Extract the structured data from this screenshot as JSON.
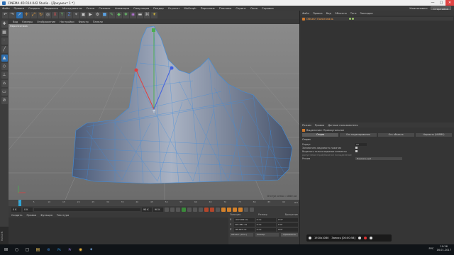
{
  "window": {
    "title": "CINEMA 4D R14.042 Studio - [Документ 1 *]",
    "controls": [
      "—",
      "□",
      "✕"
    ]
  },
  "menubar": {
    "items": [
      "Файл",
      "Правка",
      "Создать",
      "Выделить",
      "Инструменты",
      "Сетка",
      "Снэпинг",
      "Анимация",
      "Симуляция",
      "Рендер",
      "Скульпт",
      "MoGraph",
      "Персонаж",
      "Плагины",
      "Скрипт",
      "Окно",
      "Справка"
    ],
    "layout_label": "Компоновка:",
    "layout_value": "Стартовая"
  },
  "toolbar": {
    "icons": [
      "undo-icon",
      "redo-icon",
      "select-icon",
      "move-icon",
      "scale-icon",
      "rotate-icon",
      "recent-icon",
      "x-axis-icon",
      "y-axis-icon",
      "z-axis-icon",
      "coord-icon",
      "render-view-icon",
      "render-icon",
      "render-settings-icon",
      "cube-icon",
      "pen-icon",
      "subdivision-icon",
      "array-icon",
      "deformer-icon",
      "floor-icon",
      "camera-icon",
      "light-icon"
    ],
    "glyphs": [
      "↶",
      "↷",
      "➚",
      "✛",
      "⤢",
      "↻",
      "◎",
      "X",
      "Y",
      "Z",
      "⌖",
      "▣",
      "▶",
      "⚙",
      "■",
      "✎",
      "◆",
      "❖",
      "◉",
      "▬",
      "⌘",
      "☀"
    ]
  },
  "lefttools": {
    "icons": [
      "make-editable-icon",
      "texture-icon",
      "points-icon",
      "edges-icon",
      "polygons-icon",
      "model-icon",
      "axis-icon",
      "snap-icon",
      "workplane-icon",
      "magnet-icon"
    ],
    "glyphs": [
      "✚",
      "▦",
      "·",
      "╱",
      "▲",
      "◇",
      "⊥",
      "⌂",
      "▭",
      "⊘"
    ]
  },
  "viewport": {
    "menu": [
      "Вид",
      "Камеры",
      "Отображение",
      "Настройки",
      "Фильтр",
      "Панели"
    ],
    "label": "Перспектива",
    "grid_spacing": "Отступ сетки : 1000 см"
  },
  "timeline": {
    "ticks": [
      "0",
      "5",
      "10",
      "15",
      "20",
      "25",
      "30",
      "35",
      "40",
      "45",
      "50",
      "55",
      "60",
      "65",
      "70",
      "75",
      "80",
      "85",
      "90"
    ],
    "end_label": "0 K"
  },
  "transport": {
    "start": "0 K",
    "current": "0 K",
    "end": "90 K",
    "end2": "90 K"
  },
  "materials": {
    "menu": [
      "Создать",
      "Правка",
      "Функция",
      "Текстура"
    ]
  },
  "coords": {
    "headers": [
      "Позиция",
      "Размер",
      "Вращение"
    ],
    "rows": [
      {
        "axis": "X",
        "pos": "-117.002 см",
        "size": "0 см",
        "rot": "H 0°"
      },
      {
        "axis": "Y",
        "pos": "121.851 см",
        "size": "0 см",
        "rot": "P 0°"
      },
      {
        "axis": "Z",
        "pos": "-95.927 см",
        "size": "0 см",
        "rot": "B 0°"
      }
    ],
    "mode": "Объект (Отн.)",
    "size_mode": "Размер",
    "apply": "Применить"
  },
  "objects": {
    "menu": [
      "Файл",
      "Правка",
      "Вид",
      "Объекты",
      "Теги",
      "Закладки"
    ],
    "item": "Объект Полигональ"
  },
  "attributes": {
    "menu": [
      "Режим",
      "Правка",
      "Данные пользователя"
    ],
    "title": "Выделение: Прямоугольное",
    "tabs": [
      "Опции",
      "Ось моделирования",
      "Ось объекта",
      "Нарезать (NURBS)"
    ],
    "section": "Опции",
    "props": [
      {
        "label": "Радиус",
        "value": "10",
        "type": "val"
      },
      {
        "label": "Запоминать видимость нажатия",
        "value": "",
        "type": "chk"
      },
      {
        "label": "Выделять только видимые элементы",
        "value": "",
        "type": "chk"
      },
      {
        "label": "Допустимое Крой/Полигон на выделение",
        "value": "",
        "type": "dim"
      },
      {
        "label": "Режим",
        "value": "Нормальный",
        "type": "dd"
      }
    ]
  },
  "recorder": {
    "resolution": "1920x1080",
    "status": "Запись [00:00:58]"
  },
  "taskbar": {
    "icons": [
      "windows-start-icon",
      "search-icon",
      "task-view-icon",
      "explorer-icon",
      "edge-icon",
      "photoshop-icon",
      "premiere-icon",
      "chrome-icon",
      "cinema4d-icon"
    ],
    "glyphs": [
      "⊞",
      "○",
      "▢",
      "▤",
      "e",
      "Ps",
      "Pr",
      "◉",
      "✦"
    ],
    "lang": "РУС",
    "time": "19:26",
    "date": "16.01.2017"
  }
}
